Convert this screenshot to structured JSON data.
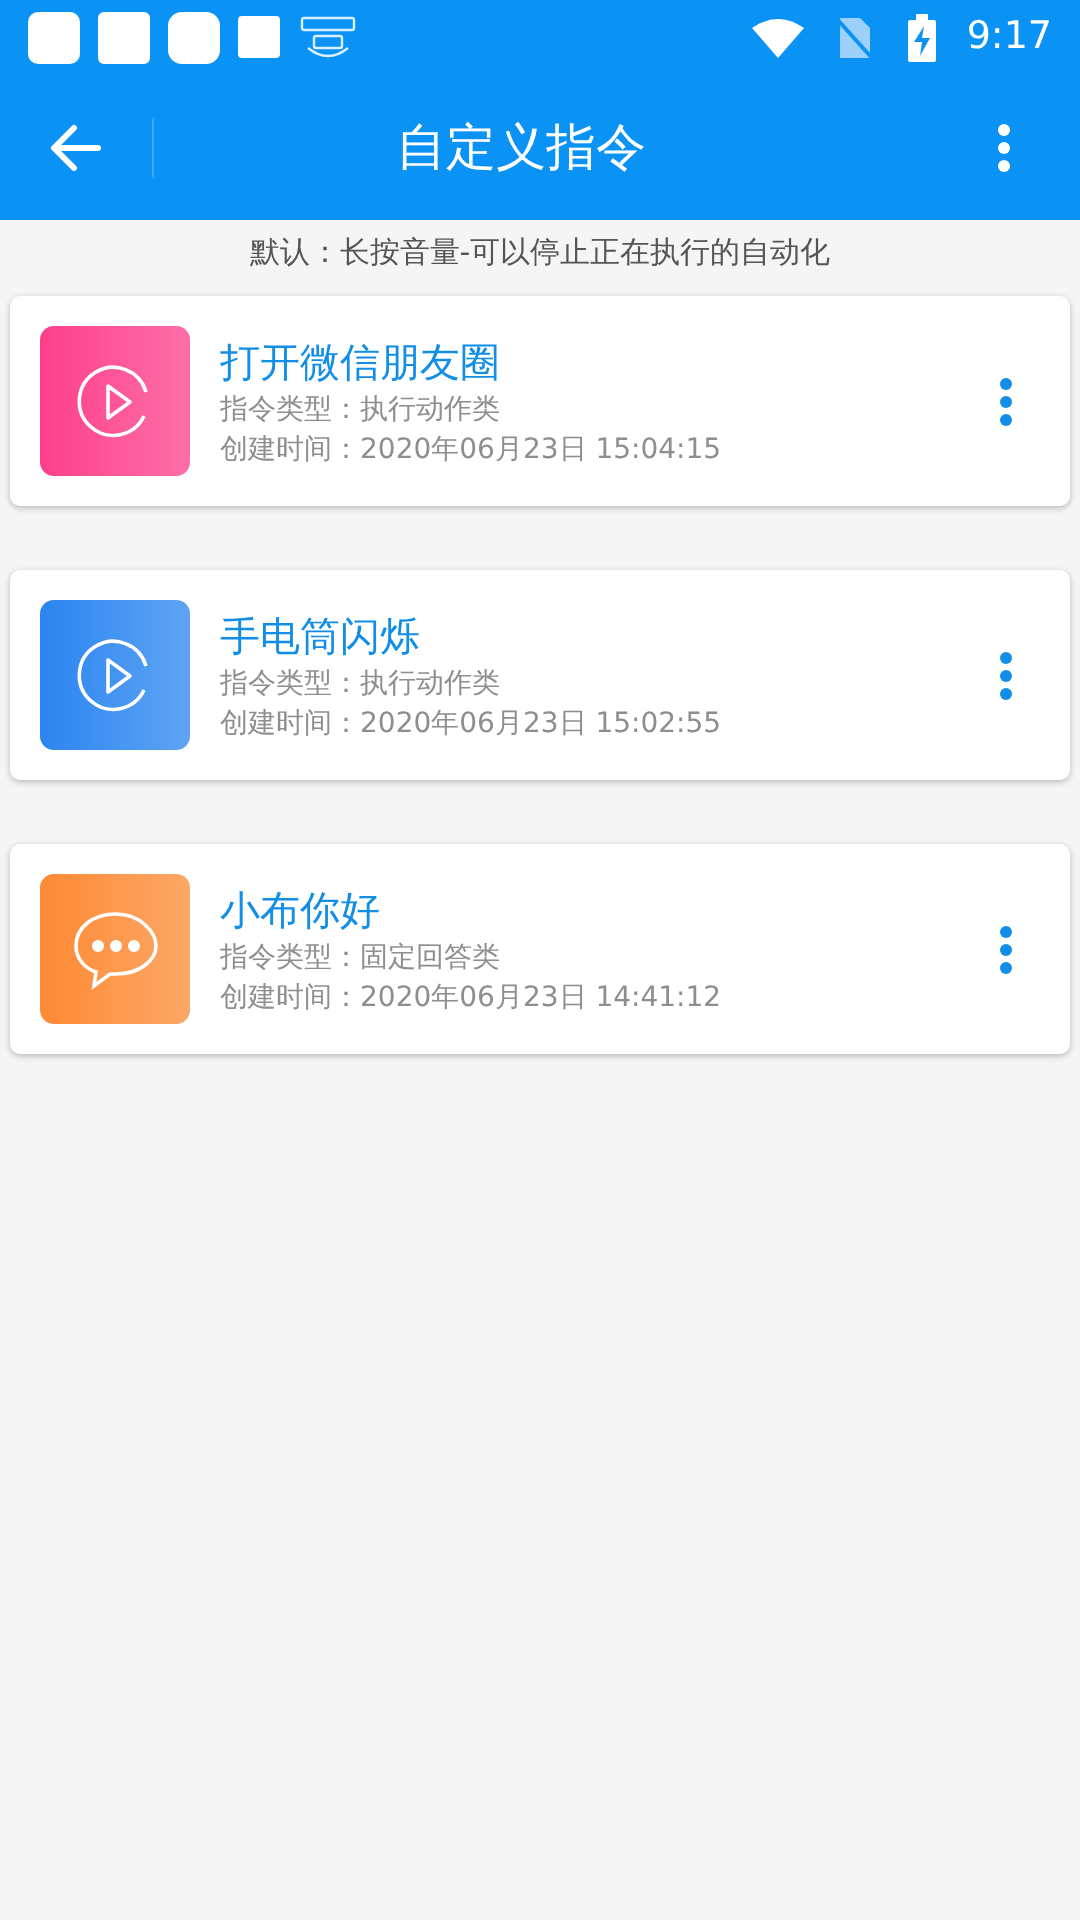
{
  "status_bar": {
    "time": "9:17"
  },
  "app_bar": {
    "title": "自定义指令"
  },
  "hint": "默认：长按音量-可以停止正在执行的自动化",
  "commands": [
    {
      "kind": "play",
      "color": "#fd3f8b",
      "name": "打开微信朋友圈",
      "type": "指令类型：执行动作类",
      "created": "创建时间：2020年06月23日 15:04:15"
    },
    {
      "kind": "play",
      "color": "#2a85f0",
      "name": "手电筒闪烁",
      "type": "指令类型：执行动作类",
      "created": "创建时间：2020年06月23日 15:02:55"
    },
    {
      "kind": "chat",
      "color": "#fd8a34",
      "name": "小布你好",
      "type": "指令类型：固定回答类",
      "created": "创建时间：2020年06月23日 14:41:12"
    }
  ]
}
